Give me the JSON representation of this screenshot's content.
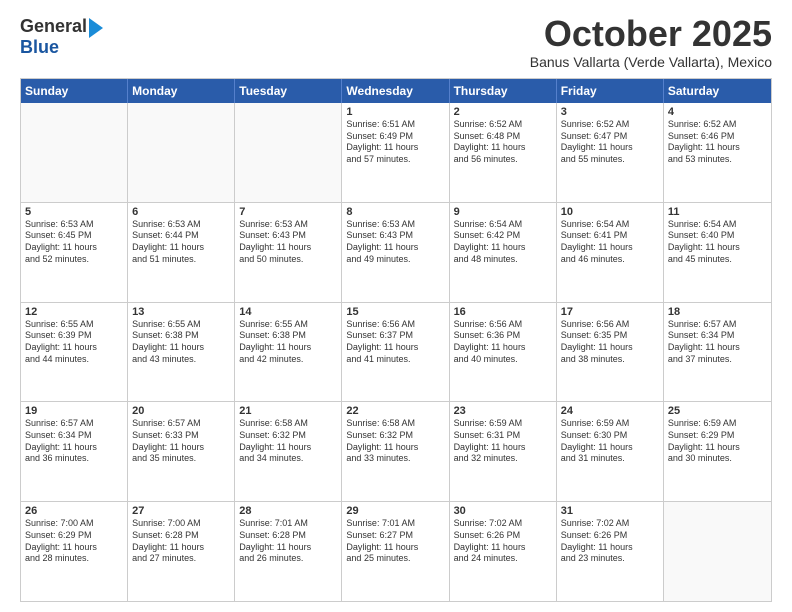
{
  "logo": {
    "general": "General",
    "blue": "Blue"
  },
  "title": "October 2025",
  "location": "Banus Vallarta (Verde Vallarta), Mexico",
  "headers": [
    "Sunday",
    "Monday",
    "Tuesday",
    "Wednesday",
    "Thursday",
    "Friday",
    "Saturday"
  ],
  "weeks": [
    [
      {
        "day": "",
        "info": ""
      },
      {
        "day": "",
        "info": ""
      },
      {
        "day": "",
        "info": ""
      },
      {
        "day": "1",
        "info": "Sunrise: 6:51 AM\nSunset: 6:49 PM\nDaylight: 11 hours\nand 57 minutes."
      },
      {
        "day": "2",
        "info": "Sunrise: 6:52 AM\nSunset: 6:48 PM\nDaylight: 11 hours\nand 56 minutes."
      },
      {
        "day": "3",
        "info": "Sunrise: 6:52 AM\nSunset: 6:47 PM\nDaylight: 11 hours\nand 55 minutes."
      },
      {
        "day": "4",
        "info": "Sunrise: 6:52 AM\nSunset: 6:46 PM\nDaylight: 11 hours\nand 53 minutes."
      }
    ],
    [
      {
        "day": "5",
        "info": "Sunrise: 6:53 AM\nSunset: 6:45 PM\nDaylight: 11 hours\nand 52 minutes."
      },
      {
        "day": "6",
        "info": "Sunrise: 6:53 AM\nSunset: 6:44 PM\nDaylight: 11 hours\nand 51 minutes."
      },
      {
        "day": "7",
        "info": "Sunrise: 6:53 AM\nSunset: 6:43 PM\nDaylight: 11 hours\nand 50 minutes."
      },
      {
        "day": "8",
        "info": "Sunrise: 6:53 AM\nSunset: 6:43 PM\nDaylight: 11 hours\nand 49 minutes."
      },
      {
        "day": "9",
        "info": "Sunrise: 6:54 AM\nSunset: 6:42 PM\nDaylight: 11 hours\nand 48 minutes."
      },
      {
        "day": "10",
        "info": "Sunrise: 6:54 AM\nSunset: 6:41 PM\nDaylight: 11 hours\nand 46 minutes."
      },
      {
        "day": "11",
        "info": "Sunrise: 6:54 AM\nSunset: 6:40 PM\nDaylight: 11 hours\nand 45 minutes."
      }
    ],
    [
      {
        "day": "12",
        "info": "Sunrise: 6:55 AM\nSunset: 6:39 PM\nDaylight: 11 hours\nand 44 minutes."
      },
      {
        "day": "13",
        "info": "Sunrise: 6:55 AM\nSunset: 6:38 PM\nDaylight: 11 hours\nand 43 minutes."
      },
      {
        "day": "14",
        "info": "Sunrise: 6:55 AM\nSunset: 6:38 PM\nDaylight: 11 hours\nand 42 minutes."
      },
      {
        "day": "15",
        "info": "Sunrise: 6:56 AM\nSunset: 6:37 PM\nDaylight: 11 hours\nand 41 minutes."
      },
      {
        "day": "16",
        "info": "Sunrise: 6:56 AM\nSunset: 6:36 PM\nDaylight: 11 hours\nand 40 minutes."
      },
      {
        "day": "17",
        "info": "Sunrise: 6:56 AM\nSunset: 6:35 PM\nDaylight: 11 hours\nand 38 minutes."
      },
      {
        "day": "18",
        "info": "Sunrise: 6:57 AM\nSunset: 6:34 PM\nDaylight: 11 hours\nand 37 minutes."
      }
    ],
    [
      {
        "day": "19",
        "info": "Sunrise: 6:57 AM\nSunset: 6:34 PM\nDaylight: 11 hours\nand 36 minutes."
      },
      {
        "day": "20",
        "info": "Sunrise: 6:57 AM\nSunset: 6:33 PM\nDaylight: 11 hours\nand 35 minutes."
      },
      {
        "day": "21",
        "info": "Sunrise: 6:58 AM\nSunset: 6:32 PM\nDaylight: 11 hours\nand 34 minutes."
      },
      {
        "day": "22",
        "info": "Sunrise: 6:58 AM\nSunset: 6:32 PM\nDaylight: 11 hours\nand 33 minutes."
      },
      {
        "day": "23",
        "info": "Sunrise: 6:59 AM\nSunset: 6:31 PM\nDaylight: 11 hours\nand 32 minutes."
      },
      {
        "day": "24",
        "info": "Sunrise: 6:59 AM\nSunset: 6:30 PM\nDaylight: 11 hours\nand 31 minutes."
      },
      {
        "day": "25",
        "info": "Sunrise: 6:59 AM\nSunset: 6:29 PM\nDaylight: 11 hours\nand 30 minutes."
      }
    ],
    [
      {
        "day": "26",
        "info": "Sunrise: 7:00 AM\nSunset: 6:29 PM\nDaylight: 11 hours\nand 28 minutes."
      },
      {
        "day": "27",
        "info": "Sunrise: 7:00 AM\nSunset: 6:28 PM\nDaylight: 11 hours\nand 27 minutes."
      },
      {
        "day": "28",
        "info": "Sunrise: 7:01 AM\nSunset: 6:28 PM\nDaylight: 11 hours\nand 26 minutes."
      },
      {
        "day": "29",
        "info": "Sunrise: 7:01 AM\nSunset: 6:27 PM\nDaylight: 11 hours\nand 25 minutes."
      },
      {
        "day": "30",
        "info": "Sunrise: 7:02 AM\nSunset: 6:26 PM\nDaylight: 11 hours\nand 24 minutes."
      },
      {
        "day": "31",
        "info": "Sunrise: 7:02 AM\nSunset: 6:26 PM\nDaylight: 11 hours\nand 23 minutes."
      },
      {
        "day": "",
        "info": ""
      }
    ]
  ]
}
